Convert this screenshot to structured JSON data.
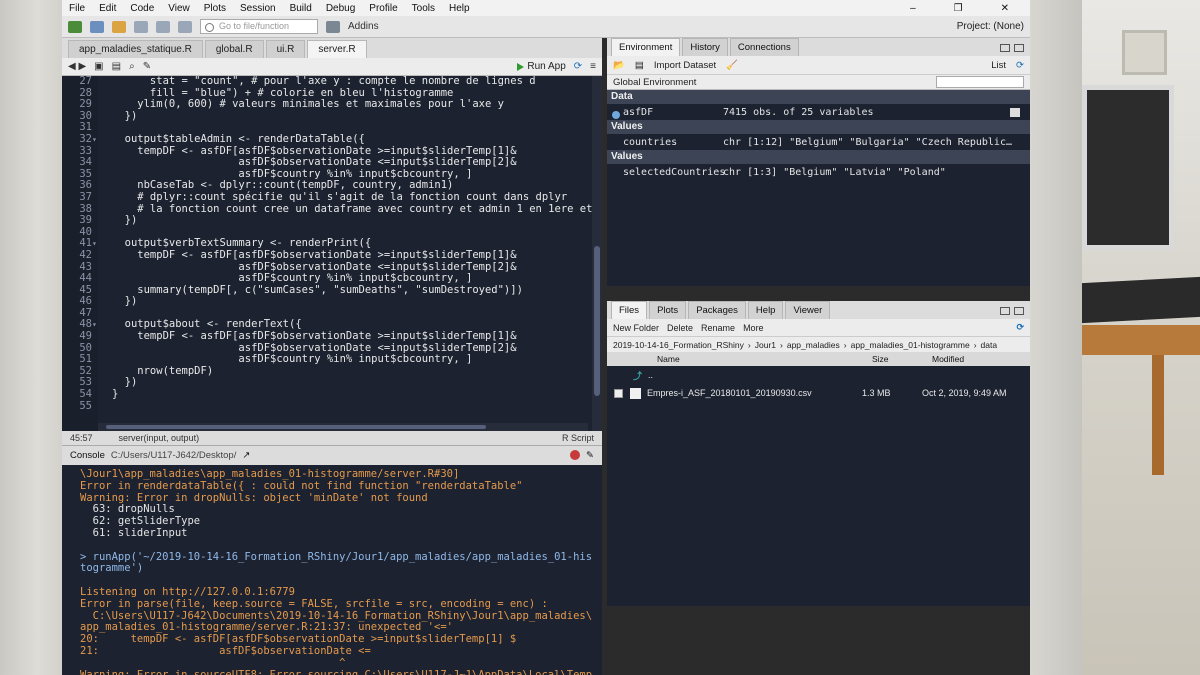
{
  "menu": [
    "File",
    "Edit",
    "Code",
    "View",
    "Plots",
    "Session",
    "Build",
    "Debug",
    "Profile",
    "Tools",
    "Help"
  ],
  "toolbar": {
    "goto_placeholder": "Go to file/function",
    "addins": "Addins",
    "project": "Project: (None)"
  },
  "source": {
    "tabs": [
      "app_maladies_statique.R",
      "global.R",
      "ui.R",
      "server.R"
    ],
    "active_tab": "server.R",
    "run_app": "Run App",
    "lines": [
      {
        "n": "27",
        "fold": "",
        "text": "      stat = \"count\", # pour l'axe y : compte le nombre de lignes d"
      },
      {
        "n": "28",
        "fold": "",
        "text": "      fill = \"blue\") + # colorie en bleu l'histogramme"
      },
      {
        "n": "29",
        "fold": "",
        "text": "    ylim(0, 600) # valeurs minimales et maximales pour l'axe y"
      },
      {
        "n": "30",
        "fold": "",
        "text": "  })"
      },
      {
        "n": "31",
        "fold": "",
        "text": ""
      },
      {
        "n": "32",
        "fold": "▾",
        "text": "  output$tableAdmin <- renderDataTable({"
      },
      {
        "n": "33",
        "fold": "",
        "text": "    tempDF <- asfDF[asfDF$observationDate >=input$sliderTemp[1]&"
      },
      {
        "n": "34",
        "fold": "",
        "text": "                    asfDF$observationDate <=input$sliderTemp[2]&"
      },
      {
        "n": "35",
        "fold": "",
        "text": "                    asfDF$country %in% input$cbcountry, ]"
      },
      {
        "n": "36",
        "fold": "",
        "text": "    nbCaseTab <- dplyr::count(tempDF, country, admin1)"
      },
      {
        "n": "37",
        "fold": "",
        "text": "    # dplyr::count spécifie qu'il s'agit de la fonction count dans dplyr"
      },
      {
        "n": "38",
        "fold": "",
        "text": "    # la fonction count cree un dataframe avec country et admin 1 en 1ere et"
      },
      {
        "n": "39",
        "fold": "",
        "text": "  })"
      },
      {
        "n": "40",
        "fold": "",
        "text": ""
      },
      {
        "n": "41",
        "fold": "▾",
        "text": "  output$verbTextSummary <- renderPrint({"
      },
      {
        "n": "42",
        "fold": "",
        "text": "    tempDF <- asfDF[asfDF$observationDate >=input$sliderTemp[1]&"
      },
      {
        "n": "43",
        "fold": "",
        "text": "                    asfDF$observationDate <=input$sliderTemp[2]&"
      },
      {
        "n": "44",
        "fold": "",
        "text": "                    asfDF$country %in% input$cbcountry, ]"
      },
      {
        "n": "45",
        "fold": "",
        "text": "    summary(tempDF[, c(\"sumCases\", \"sumDeaths\", \"sumDestroyed\")])"
      },
      {
        "n": "46",
        "fold": "",
        "text": "  })"
      },
      {
        "n": "47",
        "fold": "",
        "text": ""
      },
      {
        "n": "48",
        "fold": "▾",
        "text": "  output$about <- renderText({"
      },
      {
        "n": "49",
        "fold": "",
        "text": "    tempDF <- asfDF[asfDF$observationDate >=input$sliderTemp[1]&"
      },
      {
        "n": "50",
        "fold": "",
        "text": "                    asfDF$observationDate <=input$sliderTemp[2]&"
      },
      {
        "n": "51",
        "fold": "",
        "text": "                    asfDF$country %in% input$cbcountry, ]"
      },
      {
        "n": "52",
        "fold": "",
        "text": "    nrow(tempDF)"
      },
      {
        "n": "53",
        "fold": "",
        "text": "  })"
      },
      {
        "n": "54",
        "fold": "",
        "text": "}"
      },
      {
        "n": "55",
        "fold": "",
        "text": ""
      }
    ],
    "cursor_pos": "45:57",
    "scope": "server(input, output)",
    "file_type": "R Script"
  },
  "console": {
    "title": "Console",
    "path": "C:/Users/U117-J642/Desktop/",
    "lines": [
      {
        "cls": "c-err",
        "text": "\\Jour1\\app_maladies\\app_maladies_01-histogramme/server.R#30]"
      },
      {
        "cls": "c-err",
        "text": "Error in renderdataTable({ : could not find function \"renderdataTable\""
      },
      {
        "cls": "c-err",
        "text": "Warning: Error in dropNulls: object 'minDate' not found"
      },
      {
        "cls": "c-out",
        "text": "  63: dropNulls"
      },
      {
        "cls": "c-out",
        "text": "  62: getSliderType"
      },
      {
        "cls": "c-out",
        "text": "  61: sliderInput"
      },
      {
        "cls": "c-blank",
        "text": ""
      },
      {
        "cls": "c-cmd",
        "text": "> runApp('~/2019-10-14-16_Formation_RShiny/Jour1/app_maladies/app_maladies_01-his"
      },
      {
        "cls": "c-cmd",
        "text": "togramme')"
      },
      {
        "cls": "c-blank",
        "text": ""
      },
      {
        "cls": "c-err",
        "text": "Listening on http://127.0.0.1:6779"
      },
      {
        "cls": "c-err",
        "text": "Error in parse(file, keep.source = FALSE, srcfile = src, encoding = enc) :"
      },
      {
        "cls": "c-err",
        "text": "  C:\\Users\\U117-J642\\Documents\\2019-10-14-16_Formation_RShiny\\Jour1\\app_maladies\\"
      },
      {
        "cls": "c-err",
        "text": "app_maladies_01-histogramme/server.R:21:37: unexpected '<='"
      },
      {
        "cls": "c-err",
        "text": "20:     tempDF <- asfDF[asfDF$observationDate >=input$sliderTemp[1] $"
      },
      {
        "cls": "c-err",
        "text": "21:                   asfDF$observationDate <="
      },
      {
        "cls": "c-err",
        "text": "                                         ^"
      },
      {
        "cls": "c-err",
        "text": "Warning: Error in sourceUTF8: Error sourcing C:\\Users\\U117-J~1\\AppData\\Local\\Temp"
      }
    ]
  },
  "environment": {
    "tabs": [
      "Environment",
      "History",
      "Connections"
    ],
    "import_dataset": "Import Dataset",
    "view_mode": "List",
    "scope": "Global Environment",
    "sections": {
      "data": "Data",
      "values1": "Values",
      "values2": "Values"
    },
    "data_rows": [
      {
        "name": "asfDF",
        "value": "7415 obs. of 25 variables"
      }
    ],
    "values_rows": [
      {
        "name": "countries",
        "value": "chr [1:12] \"Belgium\" \"Bulgaria\" \"Czech Republic…"
      }
    ],
    "values2_rows": [
      {
        "name": "selectedCountries",
        "value": "chr [1:3] \"Belgium\" \"Latvia\" \"Poland\""
      }
    ]
  },
  "files": {
    "tabs": [
      "Files",
      "Plots",
      "Packages",
      "Help",
      "Viewer"
    ],
    "new_folder": "New Folder",
    "delete": "Delete",
    "rename": "Rename",
    "more": "More",
    "breadcrumb": [
      "2019-10-14-16_Formation_RShiny",
      "Jour1",
      "app_maladies",
      "app_maladies_01-histogramme",
      "data"
    ],
    "columns": {
      "name": "Name",
      "size": "Size",
      "modified": "Modified"
    },
    "parent": "..",
    "rows": [
      {
        "name": "Empres-i_ASF_20180101_20190930.csv",
        "size": "1.3 MB",
        "modified": "Oct 2, 2019, 9:49 AM"
      }
    ]
  }
}
